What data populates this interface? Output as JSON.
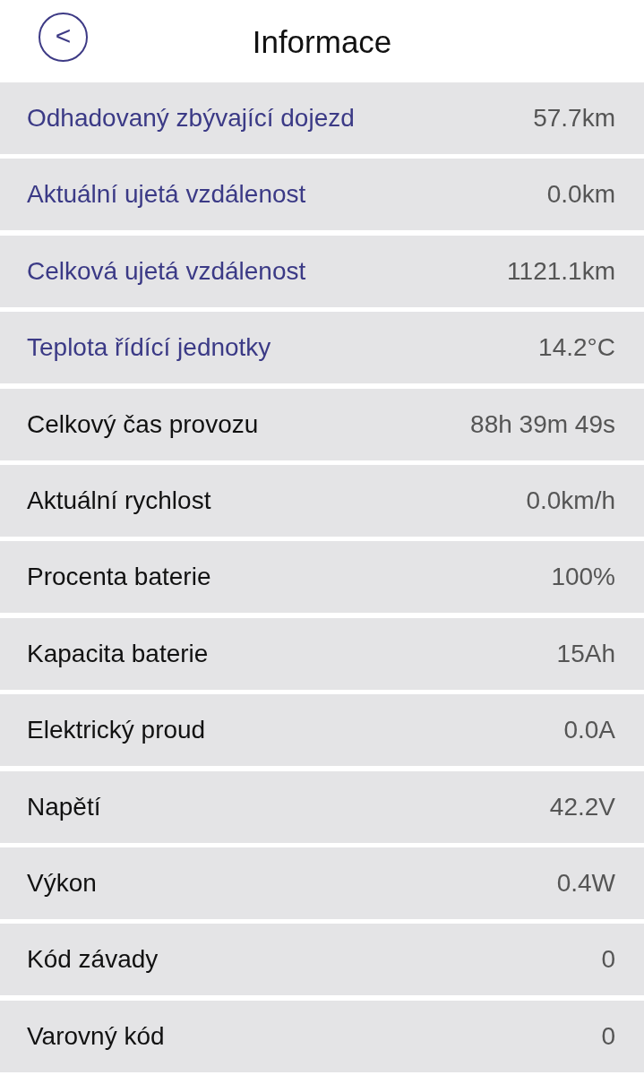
{
  "header": {
    "back": "<",
    "title": "Informace"
  },
  "rows": [
    {
      "label": "Odhadovaný zbývající dojezd",
      "value": "57.7km",
      "highlighted": true
    },
    {
      "label": "Aktuální ujetá vzdálenost",
      "value": "0.0km",
      "highlighted": true
    },
    {
      "label": "Celková ujetá vzdálenost",
      "value": "1121.1km",
      "highlighted": true
    },
    {
      "label": "Teplota řídící jednotky",
      "value": "14.2°C",
      "highlighted": true
    },
    {
      "label": "Celkový čas provozu",
      "value": "88h 39m 49s",
      "highlighted": false
    },
    {
      "label": "Aktuální rychlost",
      "value": "0.0km/h",
      "highlighted": false
    },
    {
      "label": "Procenta baterie",
      "value": "100%",
      "highlighted": false
    },
    {
      "label": "Kapacita baterie",
      "value": "15Ah",
      "highlighted": false
    },
    {
      "label": "Elektrický proud",
      "value": "0.0A",
      "highlighted": false
    },
    {
      "label": "Napětí",
      "value": "42.2V",
      "highlighted": false
    },
    {
      "label": "Výkon",
      "value": "0.4W",
      "highlighted": false
    },
    {
      "label": "Kód závady",
      "value": "0",
      "highlighted": false
    },
    {
      "label": "Varovný kód",
      "value": "0",
      "highlighted": false
    }
  ]
}
